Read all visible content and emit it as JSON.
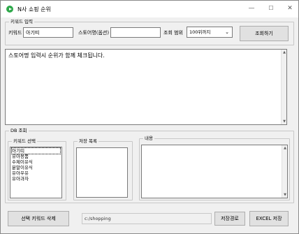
{
  "window": {
    "title": "N사 쇼핑 순위",
    "minimize_glyph": "—",
    "maximize_glyph": "☐",
    "close_glyph": "✕"
  },
  "keyword_group": {
    "label": "키워드 입력",
    "keyword_label": "키워드",
    "keyword_value": "아기띠",
    "store_label": "스토어명(옵션)",
    "store_value": "",
    "range_label": "조회 범위",
    "range_value": "100위까지",
    "search_button": "조회하기"
  },
  "output": {
    "text": "스토어명 입력시 순위가 함께 체크됩니다."
  },
  "db_group": {
    "label": "DB 조회",
    "keyword_select_label": "키워드 선택",
    "keywords": [
      "아기띠",
      "유아용품",
      "수제이유식",
      "분말이유식",
      "유아우유",
      "유아과자"
    ],
    "saved_list_label": "저장 목록",
    "content_label": "내용"
  },
  "bottom": {
    "delete_button": "선택 키워드 삭제",
    "path_value": "c:/shopping",
    "save_path_button": "저장경로",
    "excel_button": "EXCEL 저장"
  }
}
